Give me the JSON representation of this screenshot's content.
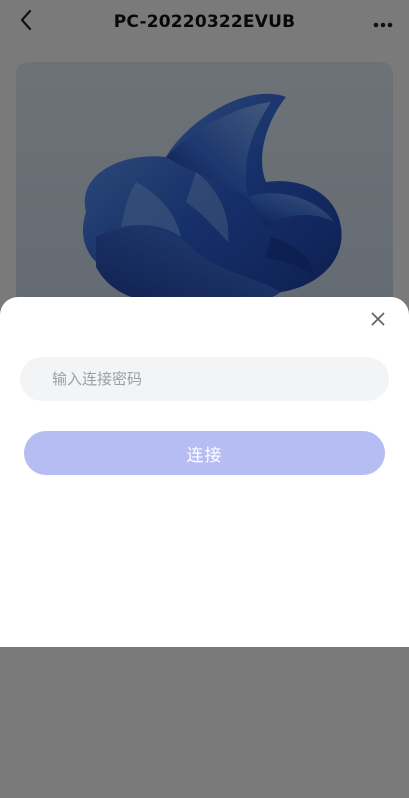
{
  "header": {
    "title": "PC-20220322EVUB",
    "back_icon": "chevron-left-icon",
    "more_icon": "more-horizontal-icon"
  },
  "preview": {
    "image": "blue-bloom-wallpaper"
  },
  "dialog": {
    "close_icon": "close-icon",
    "password_placeholder": "输入连接密码",
    "password_value": "",
    "connect_label": "连接"
  },
  "colors": {
    "accent_disabled": "#b6bdf2",
    "overlay": "#000000",
    "field_bg": "#f3f4f6",
    "bloom_blue": "#2b57c9"
  }
}
